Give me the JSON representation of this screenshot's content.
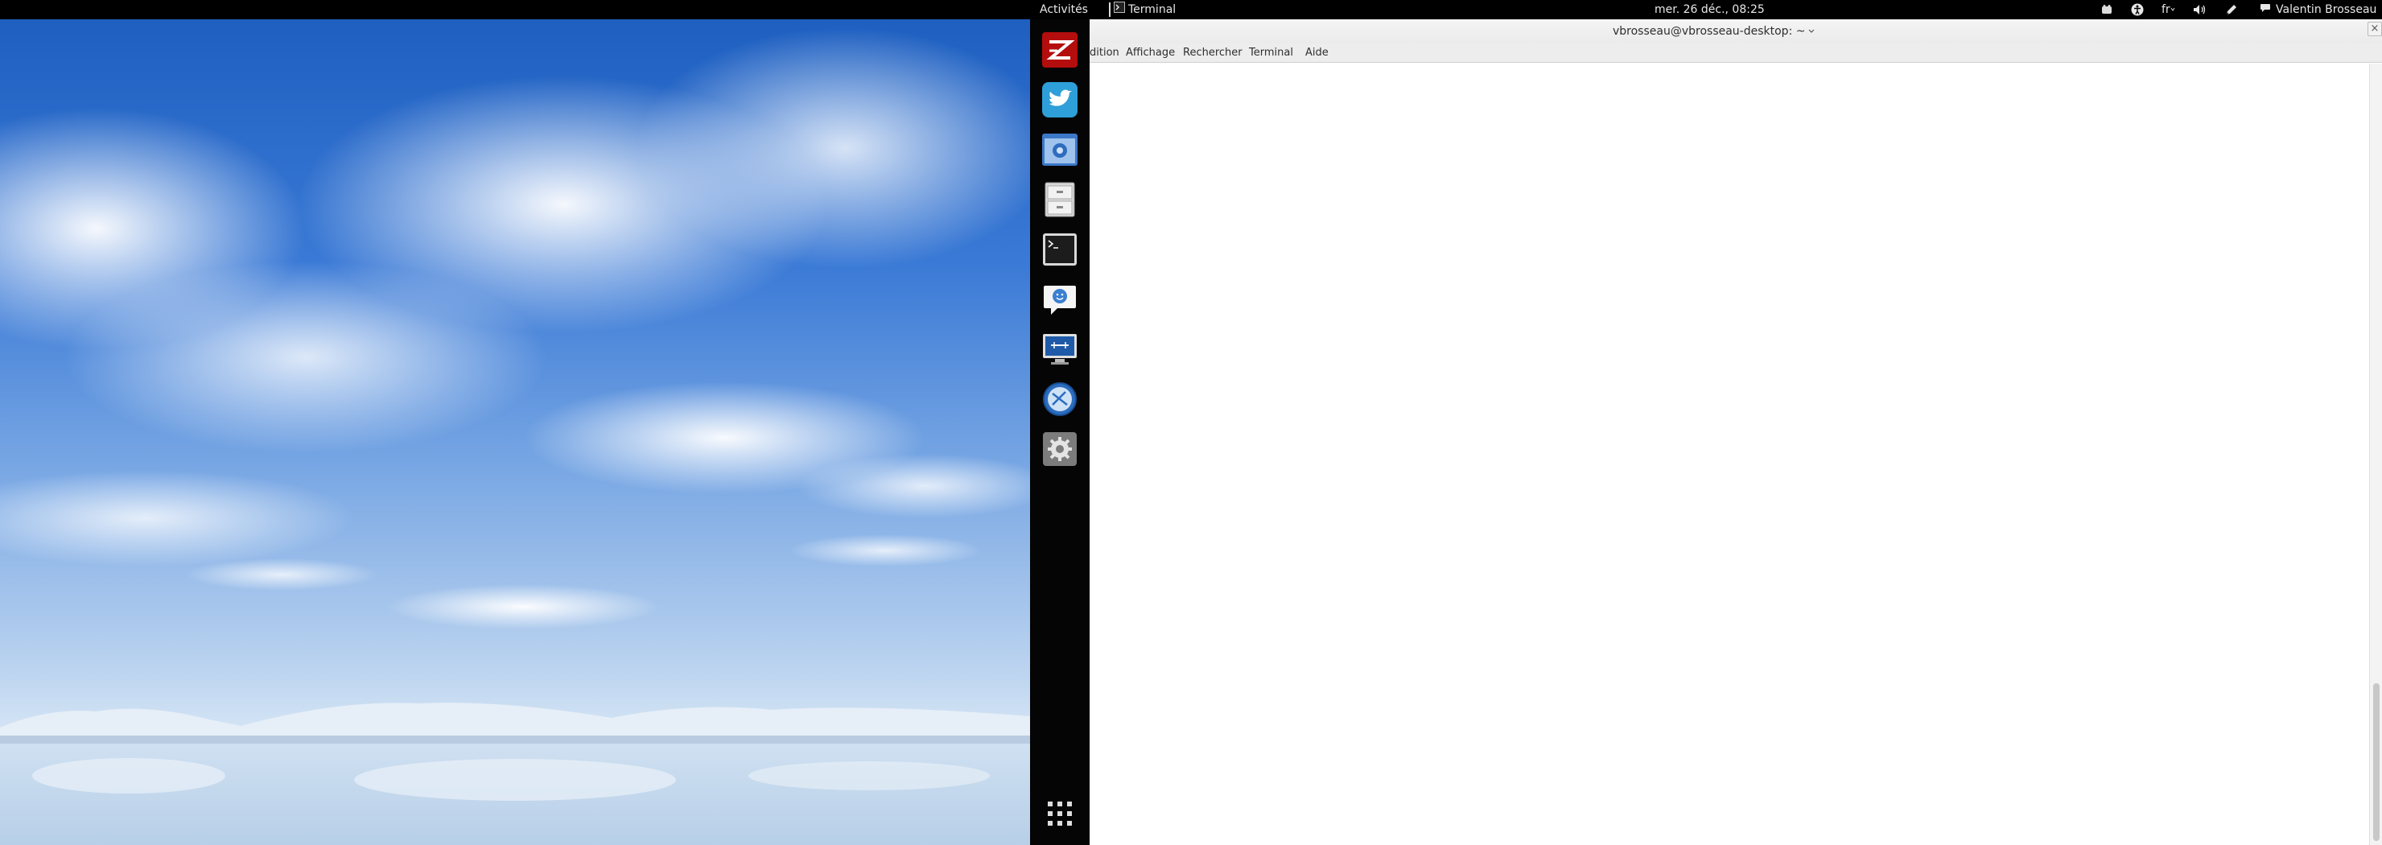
{
  "topbar": {
    "activities": "Activités",
    "app_menu": "Terminal",
    "clock": "mer. 26 déc., 08:25",
    "keyboard_layout": "fr",
    "user_name": "Valentin Brosseau",
    "status_icons": [
      "sound-indicator-icon",
      "accessibility-icon",
      "keyboard-icon",
      "volume-icon",
      "pen-icon"
    ]
  },
  "dash": {
    "apps": [
      {
        "name": "filezilla",
        "icon": "filezilla-icon"
      },
      {
        "name": "twitter",
        "icon": "twitter-icon"
      },
      {
        "name": "chromium",
        "icon": "browser-icon"
      },
      {
        "name": "files",
        "icon": "file-cabinet-icon"
      },
      {
        "name": "terminal",
        "icon": "terminal-icon"
      },
      {
        "name": "empathy",
        "icon": "chat-icon"
      },
      {
        "name": "remote-desktop",
        "icon": "monitor-icon"
      },
      {
        "name": "network",
        "icon": "network-globe-icon"
      },
      {
        "name": "settings",
        "icon": "settings-gear-icon"
      }
    ],
    "show_apps_icon": "app-grid-icon"
  },
  "terminal": {
    "title": "vbrosseau@vbrosseau-desktop: ~",
    "menu": {
      "edition": "dition",
      "affichage": "Affichage",
      "rechercher": "Rechercher",
      "terminal": "Terminal",
      "aide": "Aide"
    },
    "close_label": "×"
  }
}
